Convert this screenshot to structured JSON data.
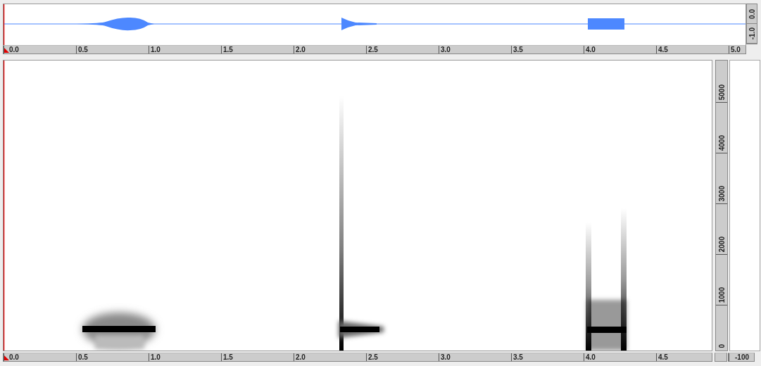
{
  "waveform": {
    "amplitude_labels": [
      "0.0",
      "-1.0"
    ]
  },
  "waveform_ruler": {
    "ticks": [
      "0.0",
      "0.5",
      "1.0",
      "1.5",
      "2.0",
      "2.5",
      "3.0",
      "3.5",
      "4.0",
      "4.5",
      "5.0"
    ]
  },
  "spectrogram": {
    "frequency_labels": [
      "0",
      "1000",
      "2000",
      "3000",
      "4000",
      "5000"
    ]
  },
  "spectrogram_ruler": {
    "ticks": [
      "0.0",
      "0.5",
      "1.0",
      "1.5",
      "2.0",
      "2.5",
      "3.0",
      "3.5",
      "4.0",
      "4.5"
    ]
  },
  "level_scale": {
    "label": "-100"
  }
}
